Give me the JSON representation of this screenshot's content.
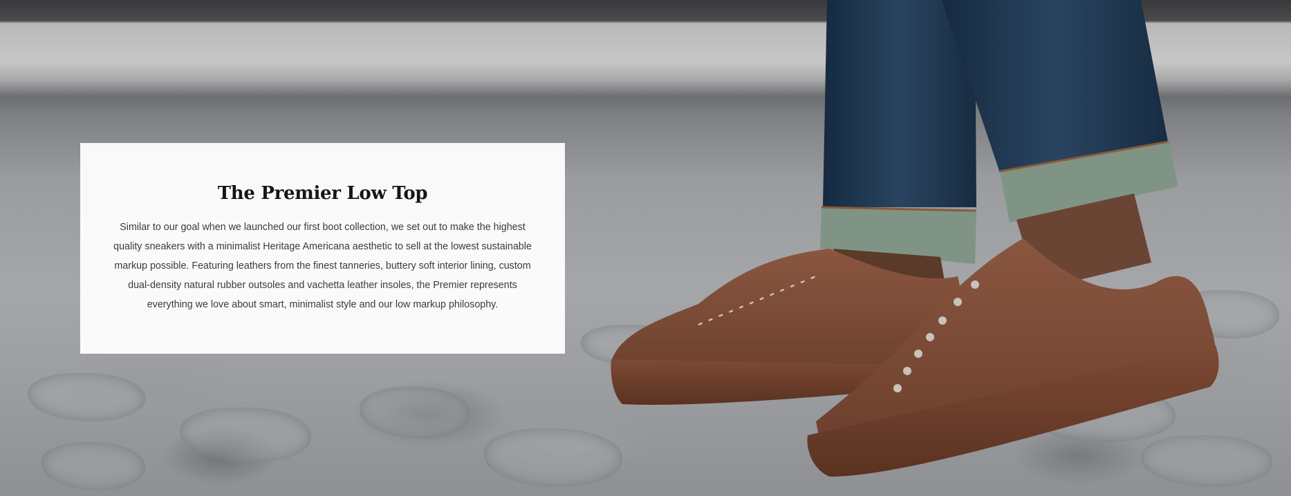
{
  "hero": {
    "image_subject": "brown-leather-low-top-sneakers-on-cobblestone",
    "title": "The Premier Low Top",
    "description": "Similar to our goal when we launched our first boot collection, we set out to make the highest quality sneakers with a minimalist Heritage Americana aesthetic to sell at the lowest sustainable markup possible. Featuring leathers from the finest tanneries, buttery soft interior lining, custom dual-density natural rubber outsoles and vachetta leather insoles, the Premier represents everything we love about smart, minimalist style and our low markup philosophy."
  },
  "colors": {
    "shoe_leather": "#7a4a34",
    "denim": "#1f3349",
    "cuff_lining": "#7f9485",
    "card_background": "#ffffff"
  }
}
